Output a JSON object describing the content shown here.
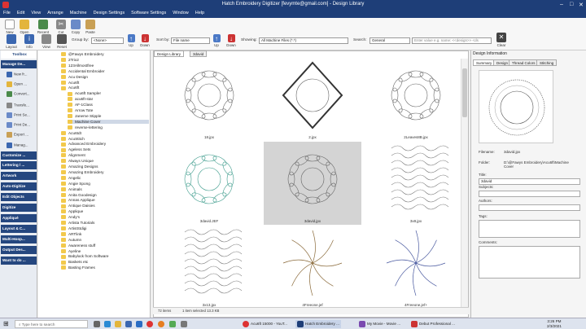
{
  "window": {
    "title": "Hatch Embroidery Digitizer [fevymte@gmail.com] - Design Library"
  },
  "menu": [
    "File",
    "Edit",
    "View",
    "Arrange",
    "Machine",
    "Design Settings",
    "Software Settings",
    "Window",
    "Help"
  ],
  "toolbar": {
    "buttons": [
      "New",
      "Open",
      "Recent",
      "Cut",
      "Copy",
      "Paste",
      "Layout",
      "Info",
      "View",
      "Reset"
    ],
    "group_by_label": "Group by:",
    "group_by_value": "<None>",
    "up_label": "Up",
    "down_label": "Down",
    "sort_by_label": "Sort by:",
    "sort_by_value": "File name",
    "sort_up": "Up",
    "sort_down": "Down",
    "showing_label": "Showing:",
    "showing_value": "All Machine Files (*.*)",
    "search_label": "Search:",
    "search_scope": "General",
    "search_placeholder": "Enter value e.g. name: <<design>> <ds",
    "clear_label": "Clear"
  },
  "left_panel": {
    "toolbox": "Toolbox",
    "manage_designs": "Manage De...",
    "items": [
      "New fr...",
      "Open ...",
      "Convert...",
      "Transfe...",
      "Print Se...",
      "Print De...",
      "Export ...",
      "Manag..."
    ],
    "sections": [
      "Customize ...",
      "Lettering / ...",
      "Artwork",
      "Auto-Digitize",
      "Edit Objects",
      "Digitize",
      "Appliqué",
      "Layout & C...",
      "Multi-Hoop...",
      "Output Des...",
      "Want to do ..."
    ]
  },
  "tree": {
    "top": [
      "@Fawys Embroidery",
      "2Trix2",
      "123Allmostfree",
      "Accidental Embroider",
      "Acu Design",
      "Acu6ft",
      "Acu6ft"
    ],
    "acu6ft_children": [
      "Acu6ft Sampler",
      "acu6ft-star",
      "AF-1Class",
      "Arrow Tote",
      "Janeme Stipple",
      "Machine Cover",
      "reverse-lettering"
    ],
    "rest": [
      "Acu6tdt",
      "AcuStitch",
      "Advanced Embroidery",
      "Ageless Sets",
      "Alignment",
      "Always Unique",
      "Amazing Designs",
      "Amazing Embroidery",
      "Angelic",
      "Angie Spong",
      "Animals",
      "Anita Goodesign",
      "Annas Applique",
      "Antique Daisies",
      "Applique",
      "Andy's",
      "Artista Tutorials",
      "ArtistStdigi",
      "ARTlink",
      "Autumn",
      "Awareness stuff",
      "Ayeline",
      "Babylock from Software",
      "Baskets etc",
      "Basting Frames"
    ]
  },
  "gallery": {
    "tabs": [
      "Design Library",
      "3david"
    ],
    "items": [
      {
        "caption": "18.jpx"
      },
      {
        "caption": "2.jpx"
      },
      {
        "caption": "2Leaves8B.jpx"
      },
      {
        "caption": "3david.JEF"
      },
      {
        "caption": "3david.jpx"
      },
      {
        "caption": "3x8.jpx"
      },
      {
        "caption": "3x13.jpx"
      },
      {
        "caption": "4Freeone.jef"
      },
      {
        "caption": "4Freeone.jef+"
      }
    ],
    "status_count": "72 items",
    "status_selected": "1 item selected  13.3 KB"
  },
  "right_panel": {
    "title": "Design Information",
    "tabs": [
      "Summary",
      "Design",
      "Thread Colors",
      "Stitching"
    ],
    "filename_label": "Filename:",
    "filename": "3david.jpx",
    "folder_label": "Folder:",
    "folder": "D:\\@Fawys Embroidery\\Acu6ft\\Machine Cover",
    "title_label": "Title:",
    "title_value": "3david",
    "subjects_label": "Subjects:",
    "authors_label": "Authors:",
    "tags_label": "Tags:",
    "comments_label": "Comments:"
  },
  "taskbar": {
    "search_placeholder": "Type here to search",
    "apps": [
      "Acu6ft 15000 - YouT...",
      "Hatch Embroidery ...",
      "My Movie - Movie ...",
      "Debut Professional ..."
    ],
    "time": "3:26 PM",
    "date": "2/3/2021"
  },
  "colors": {
    "titlebar": "#1e3e78",
    "accent": "#25477f",
    "selected": "#d4d4d4"
  }
}
